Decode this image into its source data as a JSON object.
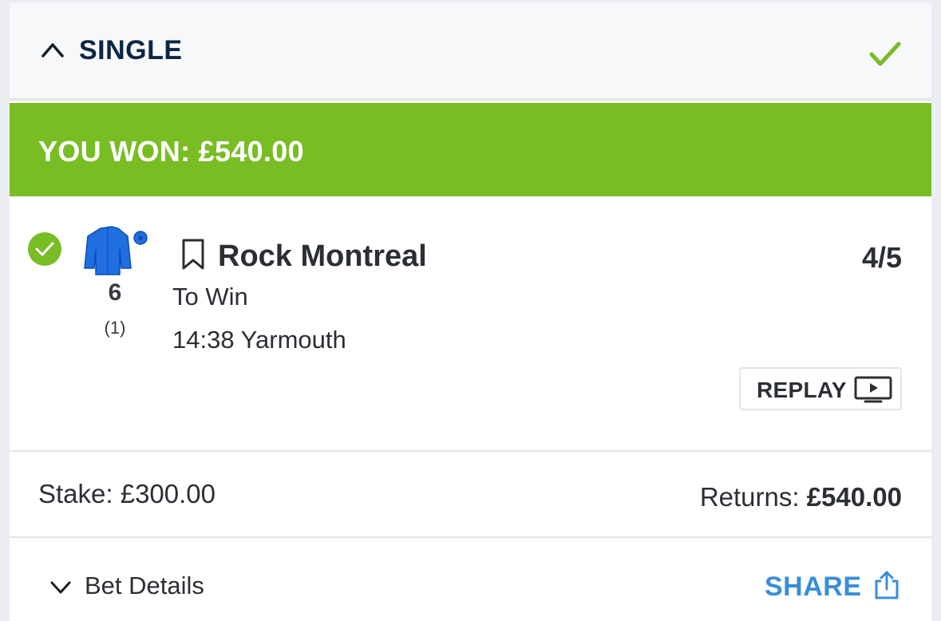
{
  "header": {
    "title": "SINGLE",
    "collapse_icon": "chevron-up-icon",
    "status_icon": "check-icon"
  },
  "banner": {
    "text": "YOU WON: £540.00",
    "color": "#78bd24"
  },
  "selection": {
    "runner_number": "6",
    "draw": "(1)",
    "horse_name": "Rock Montreal",
    "odds": "4/5",
    "market": "To Win",
    "event": "14:38 Yarmouth",
    "replay_label": "REPLAY",
    "silks_color": "#1f6fe0"
  },
  "totals": {
    "stake": "Stake: £300.00",
    "returns_label": "Returns:",
    "returns_value": "£540.00"
  },
  "footer": {
    "bet_details": "Bet Details",
    "share_label": "SHARE",
    "accent": "#3b8ed8"
  }
}
